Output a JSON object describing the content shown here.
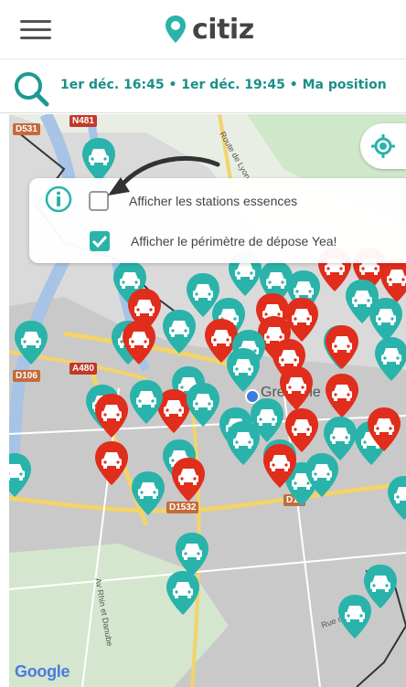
{
  "header": {
    "menu_icon": "hamburger-menu-icon",
    "logo_text": "citiz",
    "logo_icon": "location-pin-icon"
  },
  "search": {
    "icon": "search-icon",
    "summary": "1er déc. 16:45 • 1er déc. 19:45 • Ma position"
  },
  "options": {
    "info_icon": "info-icon",
    "show_fuel_stations": {
      "label": "Afficher les stations essences",
      "checked": false
    },
    "show_yea_perimeter": {
      "label": "Afficher le périmètre de dépose Yea!",
      "checked": true
    }
  },
  "map": {
    "locate_icon": "crosshair-locate-icon",
    "attribution": "Google",
    "road_labels": [
      "D531",
      "N481",
      "D106",
      "A480",
      "D1532",
      "D10"
    ],
    "street_labels": [
      "Route de Lyon",
      "Av Rhin et Danube",
      "Rue des Alliés"
    ],
    "city_label": "Grenoble"
  },
  "colors": {
    "brand_teal": "#2ab3aa",
    "station_red": "#e02d1c",
    "logo_text": "#444444"
  }
}
